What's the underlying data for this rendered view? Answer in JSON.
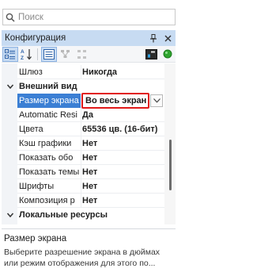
{
  "search": {
    "placeholder": "Поиск"
  },
  "panel": {
    "title": "Конфигурация"
  },
  "rows": [
    {
      "name": "Шлюз",
      "value": "Никогда"
    },
    {
      "category": "Внешний вид"
    },
    {
      "name": "Размер экрана",
      "value": "Во весь экран",
      "selected": true
    },
    {
      "name": "Automatic Resi",
      "value": "Да"
    },
    {
      "name": "Цвета",
      "value": "65536 цв. (16-бит)"
    },
    {
      "name": "Кэш графики",
      "value": "Нет"
    },
    {
      "name": "Показать обо",
      "value": "Нет"
    },
    {
      "name": "Показать темы",
      "value": "Нет"
    },
    {
      "name": "Шрифты",
      "value": "Нет"
    },
    {
      "name": "Композиция р",
      "value": "Нет"
    },
    {
      "category": "Локальные ресурсы"
    }
  ],
  "description": {
    "title": "Размер экрана",
    "text": "Выберите разрешение экрана в дюймах или режим отображения для этого по..."
  },
  "icons": {
    "search": "search-icon",
    "pin": "pin-icon",
    "close": "close-icon",
    "categorized": "categorized-view-icon",
    "alphabetical": "alphabetical-sort-icon",
    "property_pages": "property-pages-icon",
    "status": "status-green-icon"
  },
  "colors": {
    "selection": "#3b7fd4",
    "header": "#c7dbf2",
    "highlight_border": "#e11a1a",
    "status_green": "#2fa52f"
  }
}
